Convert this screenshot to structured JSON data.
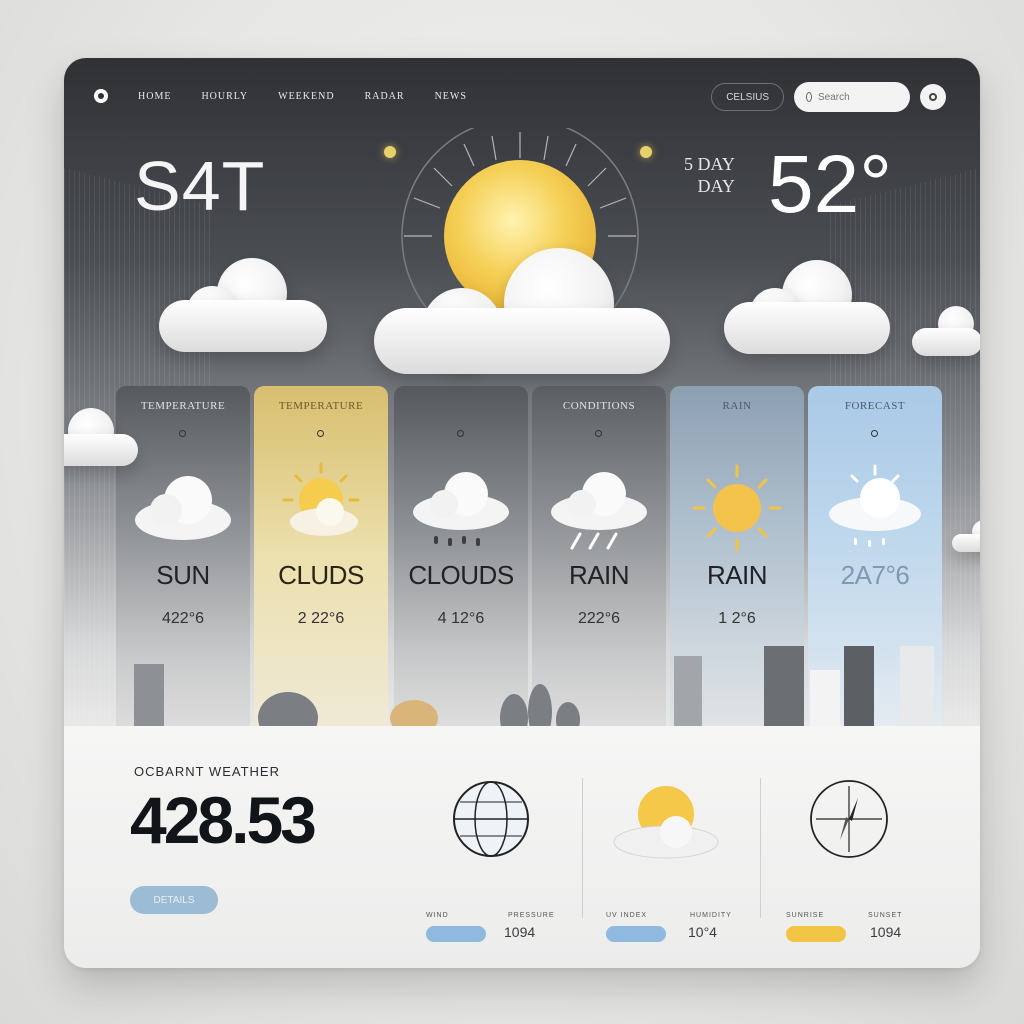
{
  "nav": {
    "links": [
      "HOME",
      "HOURLY",
      "WEEKEND",
      "RADAR",
      "NEWS"
    ],
    "unit_toggle": "CELSIUS",
    "search_placeholder": "Search"
  },
  "hero": {
    "day": "S4T",
    "forecast_line1": "5 DAY",
    "forecast_line2": "DAY",
    "temperature": "52°"
  },
  "columns": [
    {
      "header": "TEMPERATURE",
      "condition": "SUN",
      "temp": "422°6",
      "icon": "cloud-icon"
    },
    {
      "header": "TEMPERATURE",
      "condition": "CLUDS",
      "temp": "2 22°6",
      "icon": "sun-cloud-icon"
    },
    {
      "header": "",
      "condition": "CLOUDS",
      "temp": "4 12°6",
      "icon": "rain-cloud-icon"
    },
    {
      "header": "CONDITIONS",
      "condition": "RAIN",
      "temp": "222°6",
      "icon": "storm-cloud-icon"
    },
    {
      "header": "RAIN",
      "condition": "RAIN",
      "temp": "1 2°6",
      "icon": "sun-icon"
    },
    {
      "header": "FORECAST",
      "condition": "2A7°6",
      "temp": "",
      "icon": "sun-rain-cloud-icon"
    }
  ],
  "bottom": {
    "label": "OCBARNT WEATHER",
    "value": "428.53",
    "details_button": "DETAILS",
    "stats": [
      {
        "label_a": "WIND",
        "label_b": "PRESSURE",
        "value": "1094",
        "color": "#8fb9de"
      },
      {
        "label_a": "UV INDEX",
        "label_b": "HUMIDITY",
        "value": "10°4",
        "color": "#8fb9de"
      },
      {
        "label_a": "SUNRISE",
        "label_b": "SUNSET",
        "value": "1094",
        "color": "#f2c443"
      }
    ]
  },
  "colors": {
    "accent": "#f2c443",
    "sky_blue": "#a9c9e6",
    "dark": "#2f3135"
  }
}
